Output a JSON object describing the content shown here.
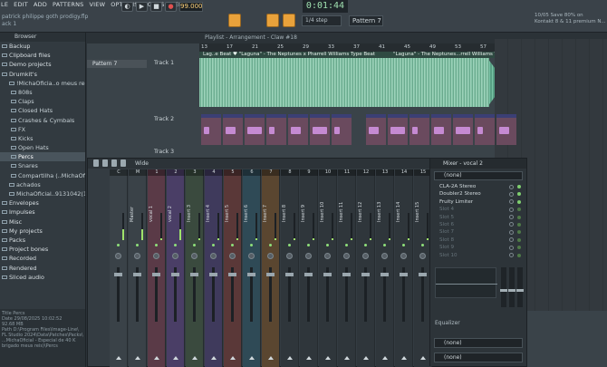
{
  "menu": [
    "LE",
    "EDIT",
    "ADD",
    "PATTERNS",
    "VIEW",
    "OPTIONS",
    "TOOLS",
    "HELP"
  ],
  "project": {
    "file": "patrick philippe goth prodigy.flp",
    "track": "ack 1"
  },
  "transport": {
    "bpm": "99.000",
    "time": "0:01:44",
    "snap": "1/4 step",
    "pattern": "Pattern 7"
  },
  "hint": {
    "line1": "10/05  Save 80% on",
    "line2": "Kontakt 8 & 11 premium N..."
  },
  "browser": {
    "title": "Browser",
    "items": [
      {
        "label": "Backup",
        "level": "top"
      },
      {
        "label": "Clipboard files",
        "level": "top"
      },
      {
        "label": "Demo projects",
        "level": "top"
      },
      {
        "label": "Drumkit's",
        "level": "top"
      },
      {
        "label": "!MichaOficia..o meus reis)",
        "level": "sub1"
      },
      {
        "label": "808s",
        "level": "sub2"
      },
      {
        "label": "Claps",
        "level": "sub2"
      },
      {
        "label": "Closed Hats",
        "level": "sub2"
      },
      {
        "label": "Crashes & Cymbals",
        "level": "sub2"
      },
      {
        "label": "FX",
        "level": "sub2"
      },
      {
        "label": "Kicks",
        "level": "sub2"
      },
      {
        "label": "Open Hats",
        "level": "sub2"
      },
      {
        "label": "Percs",
        "level": "sub2",
        "selected": true
      },
      {
        "label": "Snares",
        "level": "sub2"
      },
      {
        "label": "Compartilha (..MichaOficial",
        "level": "sub2"
      },
      {
        "label": "achados",
        "level": "sub1"
      },
      {
        "label": "MichaOficial..9131042(1-001",
        "level": "sub1"
      },
      {
        "label": "Envelopes",
        "level": "top"
      },
      {
        "label": "Impulses",
        "level": "top"
      },
      {
        "label": "Misc",
        "level": "top"
      },
      {
        "label": "My projects",
        "level": "top"
      },
      {
        "label": "Packs",
        "level": "top"
      },
      {
        "label": "Project bones",
        "level": "top"
      },
      {
        "label": "Recorded",
        "level": "top"
      },
      {
        "label": "Rendered",
        "level": "top"
      },
      {
        "label": "Sliced audio",
        "level": "top"
      }
    ],
    "info": {
      "title": "Title  Percs",
      "date": "Date   29/08/2025 10:02:52",
      "size": "       92.68 MB",
      "path1": "Path   D:\\Program Files\\Image-Line\\",
      "path2": "FL Studio 2024\\Data\\Patches\\Packs\\",
      "path3": "...MichaOficial - Especial de 40 K",
      "path4": "brigado meus reis)\\Percs"
    }
  },
  "playlist": {
    "title": "Playlist - Arrangement - Claw #18",
    "pattern": "Pattern 7",
    "ruler": [
      "13",
      "17",
      "21",
      "25",
      "29",
      "33",
      "37",
      "41",
      "45",
      "49",
      "53",
      "57",
      "61",
      "65",
      "69",
      "73"
    ],
    "tracks": [
      "Track 1",
      "Track 2",
      "Track 3"
    ],
    "clip1": "Lag..e Beat ♥  \"Laguna\" - The Neptunes x Pharrell Williams Type Beat",
    "clip2": "\"Laguna\" - The Neptunes...rrell Williams Type Beat"
  },
  "mixer": {
    "title": "Wide",
    "strips": [
      {
        "num": "C",
        "name": "",
        "cls": "master"
      },
      {
        "num": "M",
        "name": "Master",
        "cls": "master"
      },
      {
        "num": "1",
        "name": "vocal 1",
        "cls": "vox1"
      },
      {
        "num": "2",
        "name": "vocal 2",
        "cls": "vox2"
      },
      {
        "num": "3",
        "name": "Insert 3",
        "cls": "ins3"
      },
      {
        "num": "4",
        "name": "Insert 4",
        "cls": "ins4"
      },
      {
        "num": "5",
        "name": "Insert 5",
        "cls": "ins5"
      },
      {
        "num": "6",
        "name": "Insert 6",
        "cls": "ins6"
      },
      {
        "num": "7",
        "name": "Insert 7",
        "cls": "ins7"
      },
      {
        "num": "8",
        "name": "Insert 8",
        "cls": ""
      },
      {
        "num": "9",
        "name": "Insert 9",
        "cls": ""
      },
      {
        "num": "10",
        "name": "Insert 10",
        "cls": ""
      },
      {
        "num": "11",
        "name": "Insert 11",
        "cls": ""
      },
      {
        "num": "12",
        "name": "Insert 12",
        "cls": ""
      },
      {
        "num": "13",
        "name": "Insert 13",
        "cls": ""
      },
      {
        "num": "14",
        "name": "Insert 14",
        "cls": ""
      },
      {
        "num": "15",
        "name": "Insert 15",
        "cls": ""
      }
    ],
    "insert": {
      "title": "Mixer - vocal 2",
      "input": "(none)",
      "slots": [
        {
          "label": "CLA-2A Stereo",
          "active": true
        },
        {
          "label": "Doubler2 Stereo",
          "active": true
        },
        {
          "label": "Fruity Limiter",
          "active": true
        },
        {
          "label": "Slot 4",
          "active": false
        },
        {
          "label": "Slot 5",
          "active": false
        },
        {
          "label": "Slot 6",
          "active": false
        },
        {
          "label": "Slot 7",
          "active": false
        },
        {
          "label": "Slot 8",
          "active": false
        },
        {
          "label": "Slot 9",
          "active": false
        },
        {
          "label": "Slot 10",
          "active": false
        }
      ],
      "eq_label": "Equalizer",
      "out1": "(none)",
      "out2": "(none)"
    }
  }
}
